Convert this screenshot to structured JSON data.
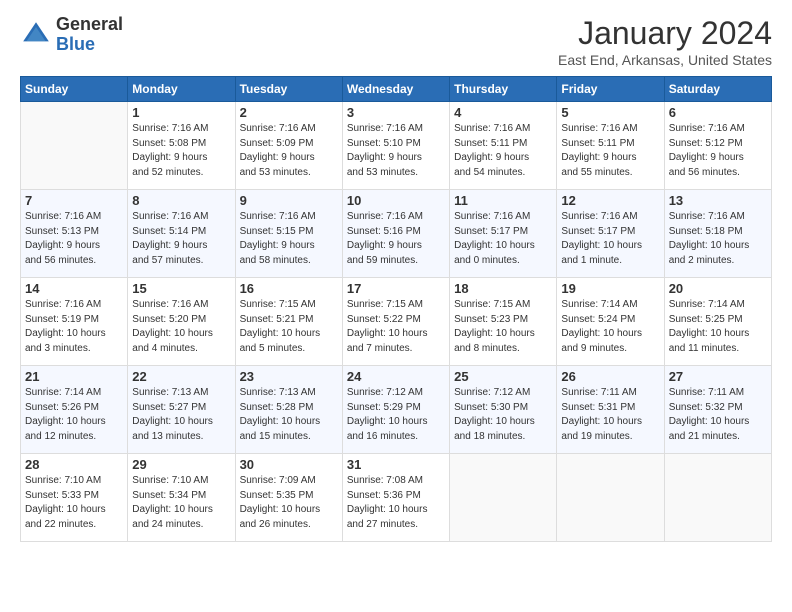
{
  "logo": {
    "general": "General",
    "blue": "Blue"
  },
  "title": "January 2024",
  "subtitle": "East End, Arkansas, United States",
  "days": [
    "Sunday",
    "Monday",
    "Tuesday",
    "Wednesday",
    "Thursday",
    "Friday",
    "Saturday"
  ],
  "weeks": [
    [
      {
        "day": "",
        "info": ""
      },
      {
        "day": "1",
        "info": "Sunrise: 7:16 AM\nSunset: 5:08 PM\nDaylight: 9 hours\nand 52 minutes."
      },
      {
        "day": "2",
        "info": "Sunrise: 7:16 AM\nSunset: 5:09 PM\nDaylight: 9 hours\nand 53 minutes."
      },
      {
        "day": "3",
        "info": "Sunrise: 7:16 AM\nSunset: 5:10 PM\nDaylight: 9 hours\nand 53 minutes."
      },
      {
        "day": "4",
        "info": "Sunrise: 7:16 AM\nSunset: 5:11 PM\nDaylight: 9 hours\nand 54 minutes."
      },
      {
        "day": "5",
        "info": "Sunrise: 7:16 AM\nSunset: 5:11 PM\nDaylight: 9 hours\nand 55 minutes."
      },
      {
        "day": "6",
        "info": "Sunrise: 7:16 AM\nSunset: 5:12 PM\nDaylight: 9 hours\nand 56 minutes."
      }
    ],
    [
      {
        "day": "7",
        "info": "Sunrise: 7:16 AM\nSunset: 5:13 PM\nDaylight: 9 hours\nand 56 minutes."
      },
      {
        "day": "8",
        "info": "Sunrise: 7:16 AM\nSunset: 5:14 PM\nDaylight: 9 hours\nand 57 minutes."
      },
      {
        "day": "9",
        "info": "Sunrise: 7:16 AM\nSunset: 5:15 PM\nDaylight: 9 hours\nand 58 minutes."
      },
      {
        "day": "10",
        "info": "Sunrise: 7:16 AM\nSunset: 5:16 PM\nDaylight: 9 hours\nand 59 minutes."
      },
      {
        "day": "11",
        "info": "Sunrise: 7:16 AM\nSunset: 5:17 PM\nDaylight: 10 hours\nand 0 minutes."
      },
      {
        "day": "12",
        "info": "Sunrise: 7:16 AM\nSunset: 5:17 PM\nDaylight: 10 hours\nand 1 minute."
      },
      {
        "day": "13",
        "info": "Sunrise: 7:16 AM\nSunset: 5:18 PM\nDaylight: 10 hours\nand 2 minutes."
      }
    ],
    [
      {
        "day": "14",
        "info": "Sunrise: 7:16 AM\nSunset: 5:19 PM\nDaylight: 10 hours\nand 3 minutes."
      },
      {
        "day": "15",
        "info": "Sunrise: 7:16 AM\nSunset: 5:20 PM\nDaylight: 10 hours\nand 4 minutes."
      },
      {
        "day": "16",
        "info": "Sunrise: 7:15 AM\nSunset: 5:21 PM\nDaylight: 10 hours\nand 5 minutes."
      },
      {
        "day": "17",
        "info": "Sunrise: 7:15 AM\nSunset: 5:22 PM\nDaylight: 10 hours\nand 7 minutes."
      },
      {
        "day": "18",
        "info": "Sunrise: 7:15 AM\nSunset: 5:23 PM\nDaylight: 10 hours\nand 8 minutes."
      },
      {
        "day": "19",
        "info": "Sunrise: 7:14 AM\nSunset: 5:24 PM\nDaylight: 10 hours\nand 9 minutes."
      },
      {
        "day": "20",
        "info": "Sunrise: 7:14 AM\nSunset: 5:25 PM\nDaylight: 10 hours\nand 11 minutes."
      }
    ],
    [
      {
        "day": "21",
        "info": "Sunrise: 7:14 AM\nSunset: 5:26 PM\nDaylight: 10 hours\nand 12 minutes."
      },
      {
        "day": "22",
        "info": "Sunrise: 7:13 AM\nSunset: 5:27 PM\nDaylight: 10 hours\nand 13 minutes."
      },
      {
        "day": "23",
        "info": "Sunrise: 7:13 AM\nSunset: 5:28 PM\nDaylight: 10 hours\nand 15 minutes."
      },
      {
        "day": "24",
        "info": "Sunrise: 7:12 AM\nSunset: 5:29 PM\nDaylight: 10 hours\nand 16 minutes."
      },
      {
        "day": "25",
        "info": "Sunrise: 7:12 AM\nSunset: 5:30 PM\nDaylight: 10 hours\nand 18 minutes."
      },
      {
        "day": "26",
        "info": "Sunrise: 7:11 AM\nSunset: 5:31 PM\nDaylight: 10 hours\nand 19 minutes."
      },
      {
        "day": "27",
        "info": "Sunrise: 7:11 AM\nSunset: 5:32 PM\nDaylight: 10 hours\nand 21 minutes."
      }
    ],
    [
      {
        "day": "28",
        "info": "Sunrise: 7:10 AM\nSunset: 5:33 PM\nDaylight: 10 hours\nand 22 minutes."
      },
      {
        "day": "29",
        "info": "Sunrise: 7:10 AM\nSunset: 5:34 PM\nDaylight: 10 hours\nand 24 minutes."
      },
      {
        "day": "30",
        "info": "Sunrise: 7:09 AM\nSunset: 5:35 PM\nDaylight: 10 hours\nand 26 minutes."
      },
      {
        "day": "31",
        "info": "Sunrise: 7:08 AM\nSunset: 5:36 PM\nDaylight: 10 hours\nand 27 minutes."
      },
      {
        "day": "",
        "info": ""
      },
      {
        "day": "",
        "info": ""
      },
      {
        "day": "",
        "info": ""
      }
    ]
  ]
}
